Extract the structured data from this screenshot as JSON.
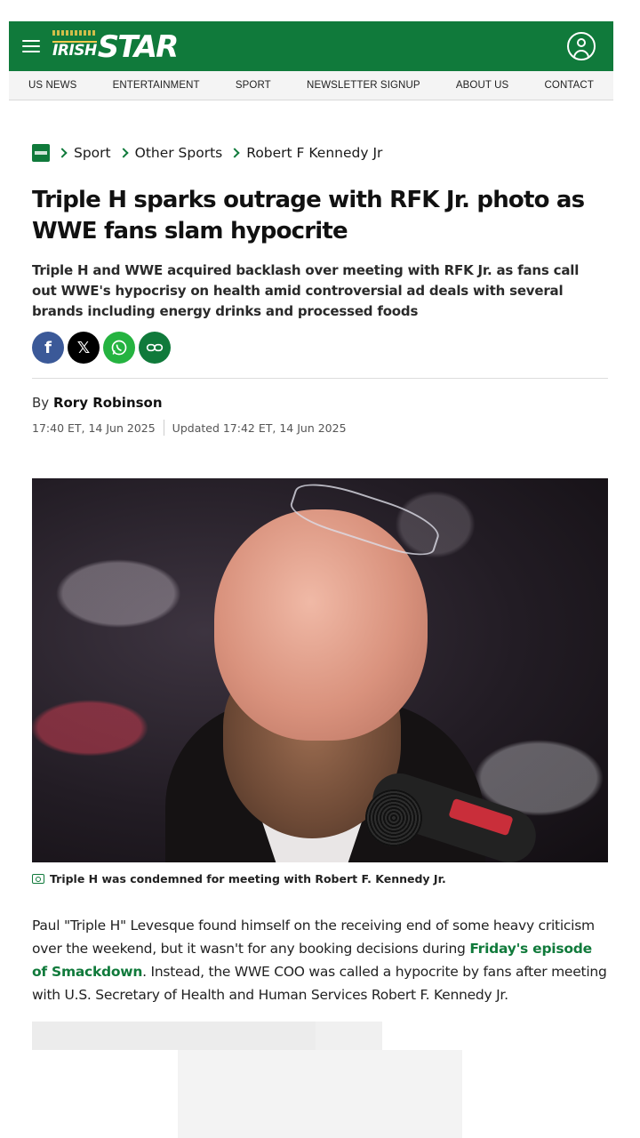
{
  "header": {
    "logo_small": "IRISH",
    "logo_large": "STAR",
    "brand_color": "#107a3b"
  },
  "nav": {
    "items": [
      {
        "label": "US NEWS"
      },
      {
        "label": "ENTERTAINMENT"
      },
      {
        "label": "SPORT"
      },
      {
        "label": "NEWSLETTER SIGNUP"
      },
      {
        "label": "ABOUT US"
      },
      {
        "label": "CONTACT"
      }
    ]
  },
  "breadcrumb": {
    "items": [
      "Sport",
      "Other Sports",
      "Robert F Kennedy Jr"
    ]
  },
  "article": {
    "headline": "Triple H sparks outrage with RFK Jr. photo as WWE fans slam hypocrite",
    "standfirst": "Triple H and WWE acquired backlash over meeting with RFK Jr. as fans call out WWE's hypocrisy on health amid controversial ad deals with several brands including energy drinks and processed foods",
    "byline_prefix": "By",
    "author": "Rory Robinson",
    "published": "17:40 ET, 14 Jun 2025",
    "updated": "Updated 17:42 ET, 14 Jun 2025",
    "caption": "Triple H was condemned for meeting with Robert F. Kennedy Jr.",
    "paragraph_1_before": "Paul \"Triple H\" Levesque found himself on the receiving end of some heavy criticism over the weekend, but it wasn't for any booking decisions during ",
    "paragraph_1_link": "Friday's episode of Smackdown",
    "paragraph_1_after": ". Instead, the WWE COO was called a hypocrite by fans after meeting with U.S. Secretary of Health and Human Services Robert F. Kennedy Jr."
  },
  "share": {
    "facebook": "f",
    "x": "𝕏"
  }
}
